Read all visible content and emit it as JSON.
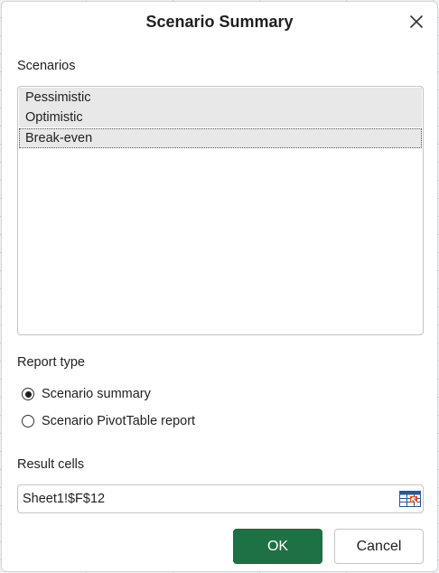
{
  "dialog": {
    "title": "Scenario Summary",
    "close_icon": "close-icon"
  },
  "scenarios": {
    "label": "Scenarios",
    "items": [
      {
        "label": "Pessimistic",
        "selected": false
      },
      {
        "label": "Optimistic",
        "selected": false
      },
      {
        "label": "Break-even",
        "selected": true
      }
    ]
  },
  "report_type": {
    "label": "Report type",
    "options": [
      {
        "label": "Scenario summary",
        "checked": true
      },
      {
        "label": "Scenario PivotTable report",
        "checked": false
      }
    ]
  },
  "result_cells": {
    "label": "Result cells",
    "value": "Sheet1!$F$12",
    "picker_icon": "range-select-icon"
  },
  "buttons": {
    "ok_label": "OK",
    "cancel_label": "Cancel"
  },
  "colors": {
    "ok_background": "#1e7145",
    "list_item_background": "#e8e8e8"
  }
}
